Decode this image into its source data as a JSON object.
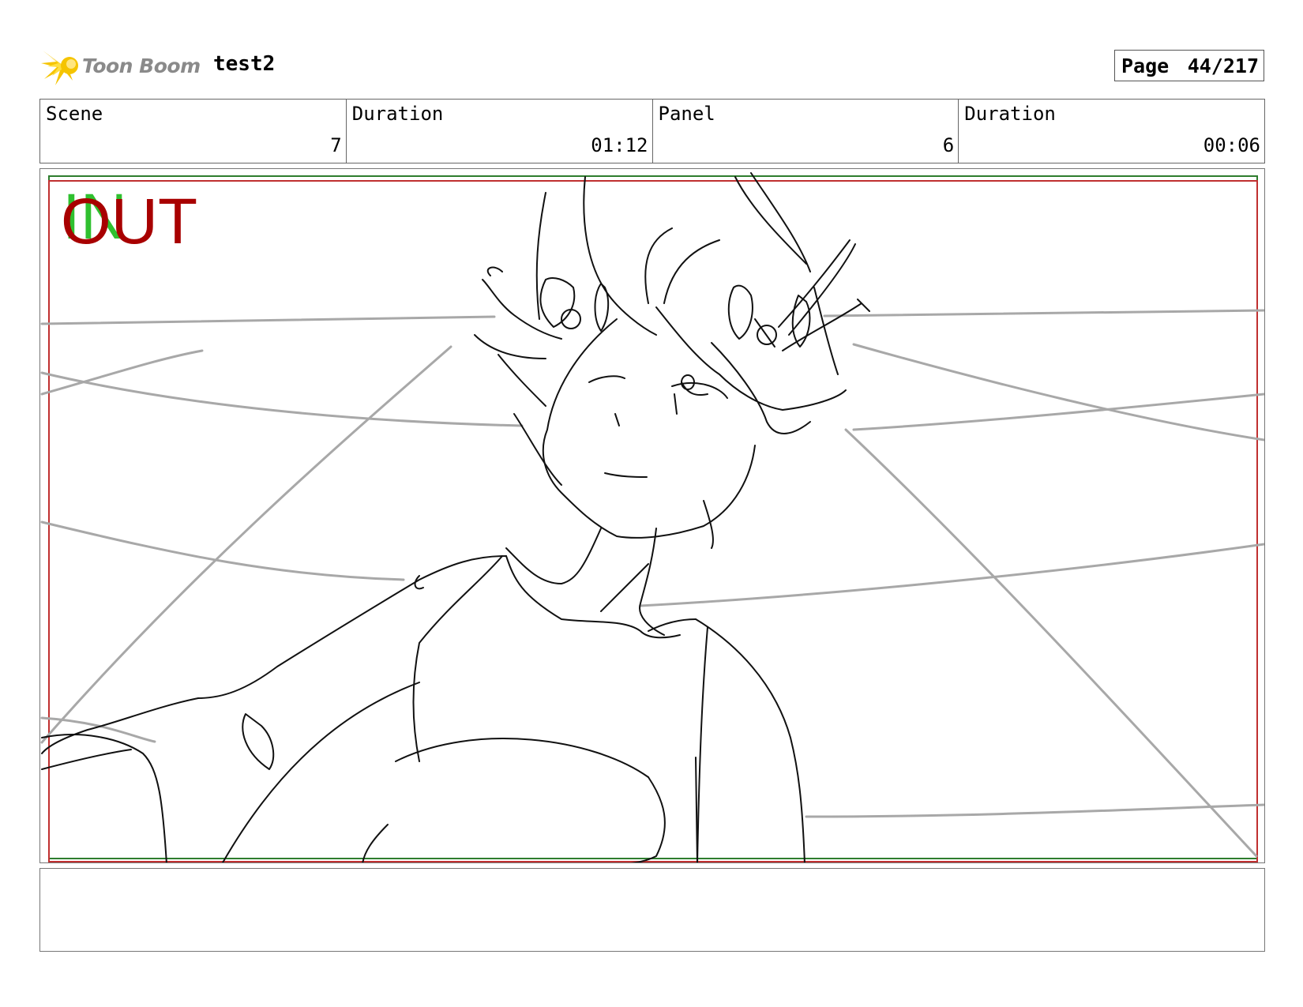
{
  "header": {
    "logo_text": "Toon Boom",
    "project_name": "test2",
    "page_label": "Page",
    "page_value": "44/217"
  },
  "info": {
    "scene_label": "Scene",
    "scene_value": "7",
    "scene_duration_label": "Duration",
    "scene_duration_value": "01:12",
    "panel_label": "Panel",
    "panel_value": "6",
    "panel_duration_label": "Duration",
    "panel_duration_value": "00:06"
  },
  "panel": {
    "in_marker": "IN",
    "out_marker": "OUT",
    "colors": {
      "in_marker": "#2fc02f",
      "out_marker": "#a80000",
      "sketch_lines": "#000000",
      "guide_lines": "#a0a0a0"
    }
  },
  "notes": {
    "text": ""
  }
}
